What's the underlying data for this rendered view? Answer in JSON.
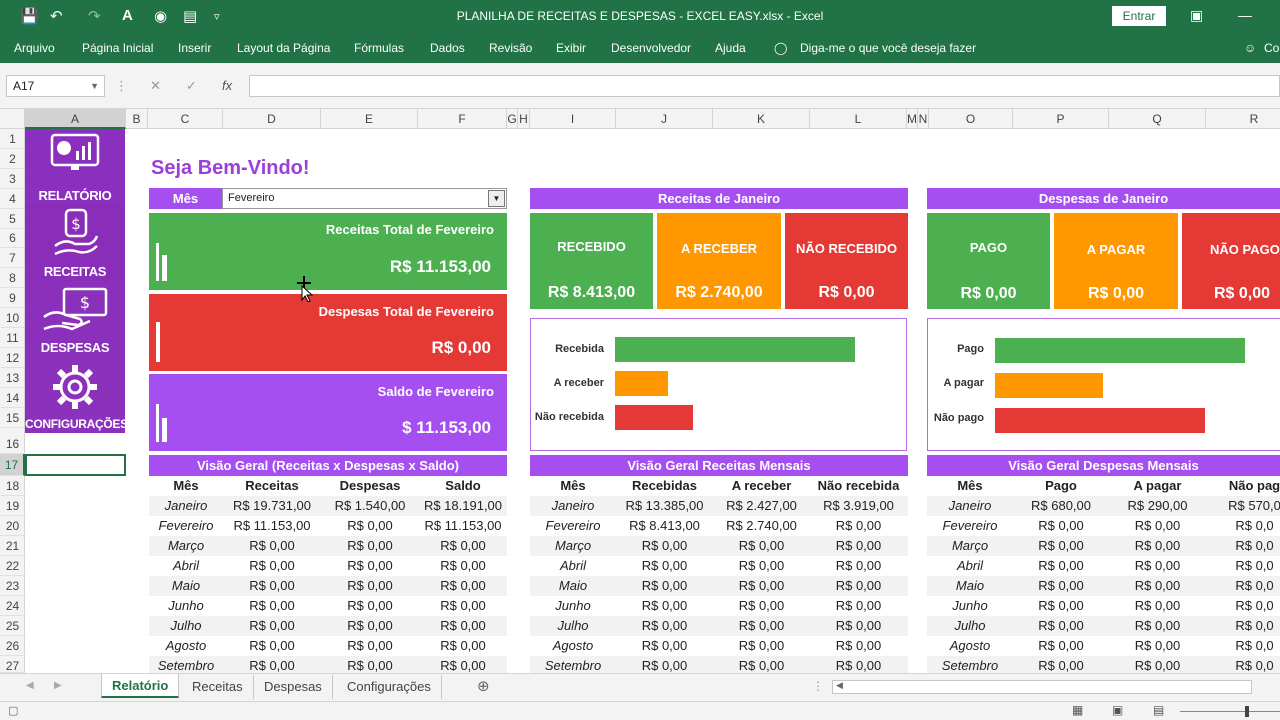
{
  "window": {
    "title": "PLANILHA DE RECEITAS E DESPESAS - EXCEL EASY.xlsx  -  Excel",
    "signin": "Entrar"
  },
  "ribbon": {
    "tabs": [
      "Arquivo",
      "Página Inicial",
      "Inserir",
      "Layout da Página",
      "Fórmulas",
      "Dados",
      "Revisão",
      "Exibir",
      "Desenvolvedor",
      "Ajuda"
    ],
    "tell_me": "Diga-me o que você deseja fazer",
    "share": "Co"
  },
  "formula": {
    "namebox": "A17",
    "value": ""
  },
  "columns": [
    "A",
    "B",
    "C",
    "D",
    "E",
    "F",
    "G",
    "H",
    "I",
    "J",
    "K",
    "L",
    "M",
    "N",
    "O",
    "P",
    "Q",
    "R"
  ],
  "rows": [
    "1",
    "2",
    "3",
    "4",
    "5",
    "6",
    "7",
    "8",
    "9",
    "10",
    "11",
    "12",
    "13",
    "14",
    "15",
    "16",
    "17",
    "18",
    "19",
    "20",
    "21",
    "22",
    "23",
    "24",
    "25",
    "26",
    "27"
  ],
  "sidebar": {
    "items": [
      "RELATÓRIO",
      "RECEITAS",
      "DESPESAS",
      "CONFIGURAÇÕES"
    ]
  },
  "welcome": "Seja Bem-Vindo!",
  "month": {
    "label": "Mês",
    "value": "Fevereiro"
  },
  "summary": {
    "receitas": {
      "title": "Receitas Total de Fevereiro",
      "value": "R$ 11.153,00",
      "color": "#4caf50"
    },
    "despesas": {
      "title": "Despesas Total de Fevereiro",
      "value": "R$ 0,00",
      "color": "#e53935"
    },
    "saldo": {
      "title": "Saldo de Fevereiro",
      "value": "$ 11.153,00",
      "color": "#a64ff0"
    }
  },
  "receitas_panel": {
    "header": "Receitas de Janeiro",
    "cards": [
      {
        "label": "RECEBIDO",
        "value": "R$ 8.413,00",
        "color": "#4caf50"
      },
      {
        "label": "A RECEBER",
        "value": "R$ 2.740,00",
        "color": "#ff9800"
      },
      {
        "label": "NÃO RECEBIDO",
        "value": "R$ 0,00",
        "color": "#e53935"
      }
    ],
    "chart": {
      "categories": [
        "Recebida",
        "A receber",
        "Não recebida"
      ],
      "fractions": [
        0.96,
        0.21,
        0.31
      ]
    }
  },
  "despesas_panel": {
    "header": "Despesas de Janeiro",
    "cards": [
      {
        "label": "PAGO",
        "value": "R$ 0,00",
        "color": "#4caf50"
      },
      {
        "label": "A PAGAR",
        "value": "R$ 0,00",
        "color": "#ff9800"
      },
      {
        "label": "NÃO PAGO",
        "value": "R$ 0,00",
        "color": "#e53935"
      }
    ],
    "chart": {
      "categories": [
        "Pago",
        "A pagar",
        "Não pago"
      ],
      "fractions": [
        1.0,
        0.43,
        0.84
      ]
    }
  },
  "overview": {
    "title": "Visão Geral (Receitas x Despesas x Saldo)",
    "headers": [
      "Mês",
      "Receitas",
      "Despesas",
      "Saldo"
    ],
    "rows": [
      [
        "Janeiro",
        "R$ 19.731,00",
        "R$ 1.540,00",
        "R$ 18.191,00"
      ],
      [
        "Fevereiro",
        "R$ 11.153,00",
        "R$ 0,00",
        "R$ 11.153,00"
      ],
      [
        "Março",
        "R$ 0,00",
        "R$ 0,00",
        "R$ 0,00"
      ],
      [
        "Abril",
        "R$ 0,00",
        "R$ 0,00",
        "R$ 0,00"
      ],
      [
        "Maio",
        "R$ 0,00",
        "R$ 0,00",
        "R$ 0,00"
      ],
      [
        "Junho",
        "R$ 0,00",
        "R$ 0,00",
        "R$ 0,00"
      ],
      [
        "Julho",
        "R$ 0,00",
        "R$ 0,00",
        "R$ 0,00"
      ],
      [
        "Agosto",
        "R$ 0,00",
        "R$ 0,00",
        "R$ 0,00"
      ],
      [
        "Setembro",
        "R$ 0,00",
        "R$ 0,00",
        "R$ 0,00"
      ]
    ]
  },
  "receitas_mensais": {
    "title": "Visão Geral Receitas Mensais",
    "headers": [
      "Mês",
      "Recebidas",
      "A receber",
      "Não recebida"
    ],
    "rows": [
      [
        "Janeiro",
        "R$ 13.385,00",
        "R$ 2.427,00",
        "R$ 3.919,00"
      ],
      [
        "Fevereiro",
        "R$ 8.413,00",
        "R$ 2.740,00",
        "R$ 0,00"
      ],
      [
        "Março",
        "R$ 0,00",
        "R$ 0,00",
        "R$ 0,00"
      ],
      [
        "Abril",
        "R$ 0,00",
        "R$ 0,00",
        "R$ 0,00"
      ],
      [
        "Maio",
        "R$ 0,00",
        "R$ 0,00",
        "R$ 0,00"
      ],
      [
        "Junho",
        "R$ 0,00",
        "R$ 0,00",
        "R$ 0,00"
      ],
      [
        "Julho",
        "R$ 0,00",
        "R$ 0,00",
        "R$ 0,00"
      ],
      [
        "Agosto",
        "R$ 0,00",
        "R$ 0,00",
        "R$ 0,00"
      ],
      [
        "Setembro",
        "R$ 0,00",
        "R$ 0,00",
        "R$ 0,00"
      ]
    ]
  },
  "despesas_mensais": {
    "title": "Visão Geral Despesas Mensais",
    "headers": [
      "Mês",
      "Pago",
      "A pagar",
      "Não pag"
    ],
    "rows": [
      [
        "Janeiro",
        "R$ 680,00",
        "R$ 290,00",
        "R$ 570,0"
      ],
      [
        "Fevereiro",
        "R$ 0,00",
        "R$ 0,00",
        "R$ 0,0"
      ],
      [
        "Março",
        "R$ 0,00",
        "R$ 0,00",
        "R$ 0,0"
      ],
      [
        "Abril",
        "R$ 0,00",
        "R$ 0,00",
        "R$ 0,0"
      ],
      [
        "Maio",
        "R$ 0,00",
        "R$ 0,00",
        "R$ 0,0"
      ],
      [
        "Junho",
        "R$ 0,00",
        "R$ 0,00",
        "R$ 0,0"
      ],
      [
        "Julho",
        "R$ 0,00",
        "R$ 0,00",
        "R$ 0,0"
      ],
      [
        "Agosto",
        "R$ 0,00",
        "R$ 0,00",
        "R$ 0,0"
      ],
      [
        "Setembro",
        "R$ 0,00",
        "R$ 0,00",
        "R$ 0,0"
      ]
    ]
  },
  "sheets": {
    "tabs": [
      "Relatório",
      "Receitas",
      "Despesas",
      "Configurações"
    ],
    "active": "Relatório"
  }
}
